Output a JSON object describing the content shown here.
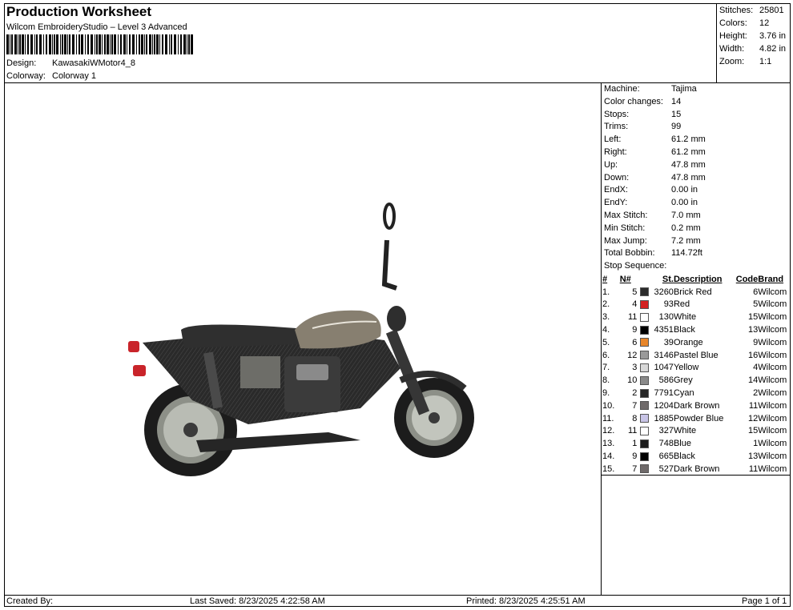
{
  "header": {
    "title": "Production Worksheet",
    "subtitle": "Wilcom EmbroideryStudio – Level 3 Advanced",
    "design_label": "Design:",
    "design_value": "KawasakiWMotor4_8",
    "colorway_label": "Colorway:",
    "colorway_value": "Colorway 1"
  },
  "stats": [
    {
      "label": "Stitches:",
      "value": "25801"
    },
    {
      "label": "Colors:",
      "value": "12"
    },
    {
      "label": "Height:",
      "value": "3.76 in"
    },
    {
      "label": "Width:",
      "value": "4.82 in"
    },
    {
      "label": "Zoom:",
      "value": "1:1"
    }
  ],
  "specs": [
    {
      "label": "Machine:",
      "value": "Tajima"
    },
    {
      "label": "Color changes:",
      "value": "14"
    },
    {
      "label": "Stops:",
      "value": "15"
    },
    {
      "label": "Trims:",
      "value": "99"
    },
    {
      "label": "Left:",
      "value": "61.2 mm"
    },
    {
      "label": "Right:",
      "value": "61.2 mm"
    },
    {
      "label": "Up:",
      "value": "47.8 mm"
    },
    {
      "label": "Down:",
      "value": "47.8 mm"
    },
    {
      "label": "EndX:",
      "value": "0.00 in"
    },
    {
      "label": "EndY:",
      "value": "0.00 in"
    },
    {
      "label": "Max Stitch:",
      "value": "7.0 mm"
    },
    {
      "label": "Min Stitch:",
      "value": "0.2 mm"
    },
    {
      "label": "Max Jump:",
      "value": "7.2 mm"
    },
    {
      "label": "Total Bobbin:",
      "value": "114.72ft"
    }
  ],
  "stop_sequence": {
    "title": "Stop Sequence:",
    "headers": {
      "idx": "#",
      "n": "N#",
      "st": "St.",
      "desc": "Description",
      "code": "Code",
      "brand": "Brand"
    },
    "rows": [
      {
        "idx": "1.",
        "n": "5",
        "color": "#2b2b2b",
        "st": "3260",
        "desc": "Brick Red",
        "code": "6",
        "brand": "Wilcom"
      },
      {
        "idx": "2.",
        "n": "4",
        "color": "#d32020",
        "st": "93",
        "desc": "Red",
        "code": "5",
        "brand": "Wilcom"
      },
      {
        "idx": "3.",
        "n": "11",
        "color": "#ffffff",
        "st": "130",
        "desc": "White",
        "code": "15",
        "brand": "Wilcom"
      },
      {
        "idx": "4.",
        "n": "9",
        "color": "#000000",
        "st": "4351",
        "desc": "Black",
        "code": "13",
        "brand": "Wilcom"
      },
      {
        "idx": "5.",
        "n": "6",
        "color": "#e8862a",
        "st": "39",
        "desc": "Orange",
        "code": "9",
        "brand": "Wilcom"
      },
      {
        "idx": "6.",
        "n": "12",
        "color": "#9a9a9a",
        "st": "3146",
        "desc": "Pastel Blue",
        "code": "16",
        "brand": "Wilcom"
      },
      {
        "idx": "7.",
        "n": "3",
        "color": "#d8d8d8",
        "st": "1047",
        "desc": "Yellow",
        "code": "4",
        "brand": "Wilcom"
      },
      {
        "idx": "8.",
        "n": "10",
        "color": "#8a8a8a",
        "st": "586",
        "desc": "Grey",
        "code": "14",
        "brand": "Wilcom"
      },
      {
        "idx": "9.",
        "n": "2",
        "color": "#262626",
        "st": "7791",
        "desc": "Cyan",
        "code": "2",
        "brand": "Wilcom"
      },
      {
        "idx": "10.",
        "n": "7",
        "color": "#6f6a6a",
        "st": "1204",
        "desc": "Dark Brown",
        "code": "11",
        "brand": "Wilcom"
      },
      {
        "idx": "11.",
        "n": "8",
        "color": "#c8c4e6",
        "st": "1885",
        "desc": "Powder Blue",
        "code": "12",
        "brand": "Wilcom"
      },
      {
        "idx": "12.",
        "n": "11",
        "color": "#ffffff",
        "st": "327",
        "desc": "White",
        "code": "15",
        "brand": "Wilcom"
      },
      {
        "idx": "13.",
        "n": "1",
        "color": "#1c1c1c",
        "st": "748",
        "desc": "Blue",
        "code": "1",
        "brand": "Wilcom"
      },
      {
        "idx": "14.",
        "n": "9",
        "color": "#000000",
        "st": "665",
        "desc": "Black",
        "code": "13",
        "brand": "Wilcom"
      },
      {
        "idx": "15.",
        "n": "7",
        "color": "#6f6a6a",
        "st": "527",
        "desc": "Dark Brown",
        "code": "11",
        "brand": "Wilcom"
      }
    ]
  },
  "footer": {
    "created_by": "Created By:",
    "last_saved": "Last Saved: 8/23/2025 4:22:58 AM",
    "printed": "Printed: 8/23/2025 4:25:51 AM",
    "page": "Page 1 of 1"
  }
}
